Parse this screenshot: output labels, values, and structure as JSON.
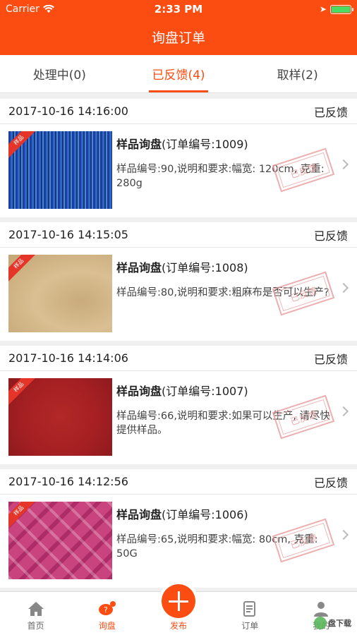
{
  "status": {
    "carrier": "Carrier",
    "time": "2:33 PM"
  },
  "header": {
    "title": "询盘订单"
  },
  "tabs": [
    {
      "label": "处理中(0)"
    },
    {
      "label": "已反馈(4)"
    },
    {
      "label": "取样(2)"
    }
  ],
  "orders": [
    {
      "date": "2017-10-16 14:16:00",
      "status": "已反馈",
      "title": "样品询盘",
      "order_no": "(订单编号:1009)",
      "desc": "样品编号:90,说明和要求:幅宽: 120cm, 克重: 280g",
      "ribbon": "样品",
      "stamp": "已反馈"
    },
    {
      "date": "2017-10-16 14:15:05",
      "status": "已反馈",
      "title": "样品询盘",
      "order_no": "(订单编号:1008)",
      "desc": "样品编号:80,说明和要求:粗麻布是否可以生产?",
      "ribbon": "样品",
      "stamp": "已反馈"
    },
    {
      "date": "2017-10-16 14:14:06",
      "status": "已反馈",
      "title": "样品询盘",
      "order_no": "(订单编号:1007)",
      "desc": "样品编号:66,说明和要求:如果可以生产, 请尽快提供样品。",
      "ribbon": "样品",
      "stamp": "已反馈"
    },
    {
      "date": "2017-10-16 14:12:56",
      "status": "已反馈",
      "title": "样品询盘",
      "order_no": "(订单编号:1006)",
      "desc": "样品编号:65,说明和要求:幅宽: 80cm, 克重: 50G",
      "ribbon": "样品",
      "stamp": "已反馈"
    }
  ],
  "tabbar": [
    {
      "label": "首页",
      "icon": "home-icon"
    },
    {
      "label": "询盘",
      "icon": "inquiry-icon"
    },
    {
      "label": "发布",
      "icon": "plus-icon"
    },
    {
      "label": "订单",
      "icon": "order-icon"
    },
    {
      "label": "我的",
      "icon": "user-icon"
    }
  ],
  "watermark": {
    "text": "盘下载"
  },
  "colors": {
    "accent": "#fb4d12",
    "stamp": "#e89a9a"
  }
}
